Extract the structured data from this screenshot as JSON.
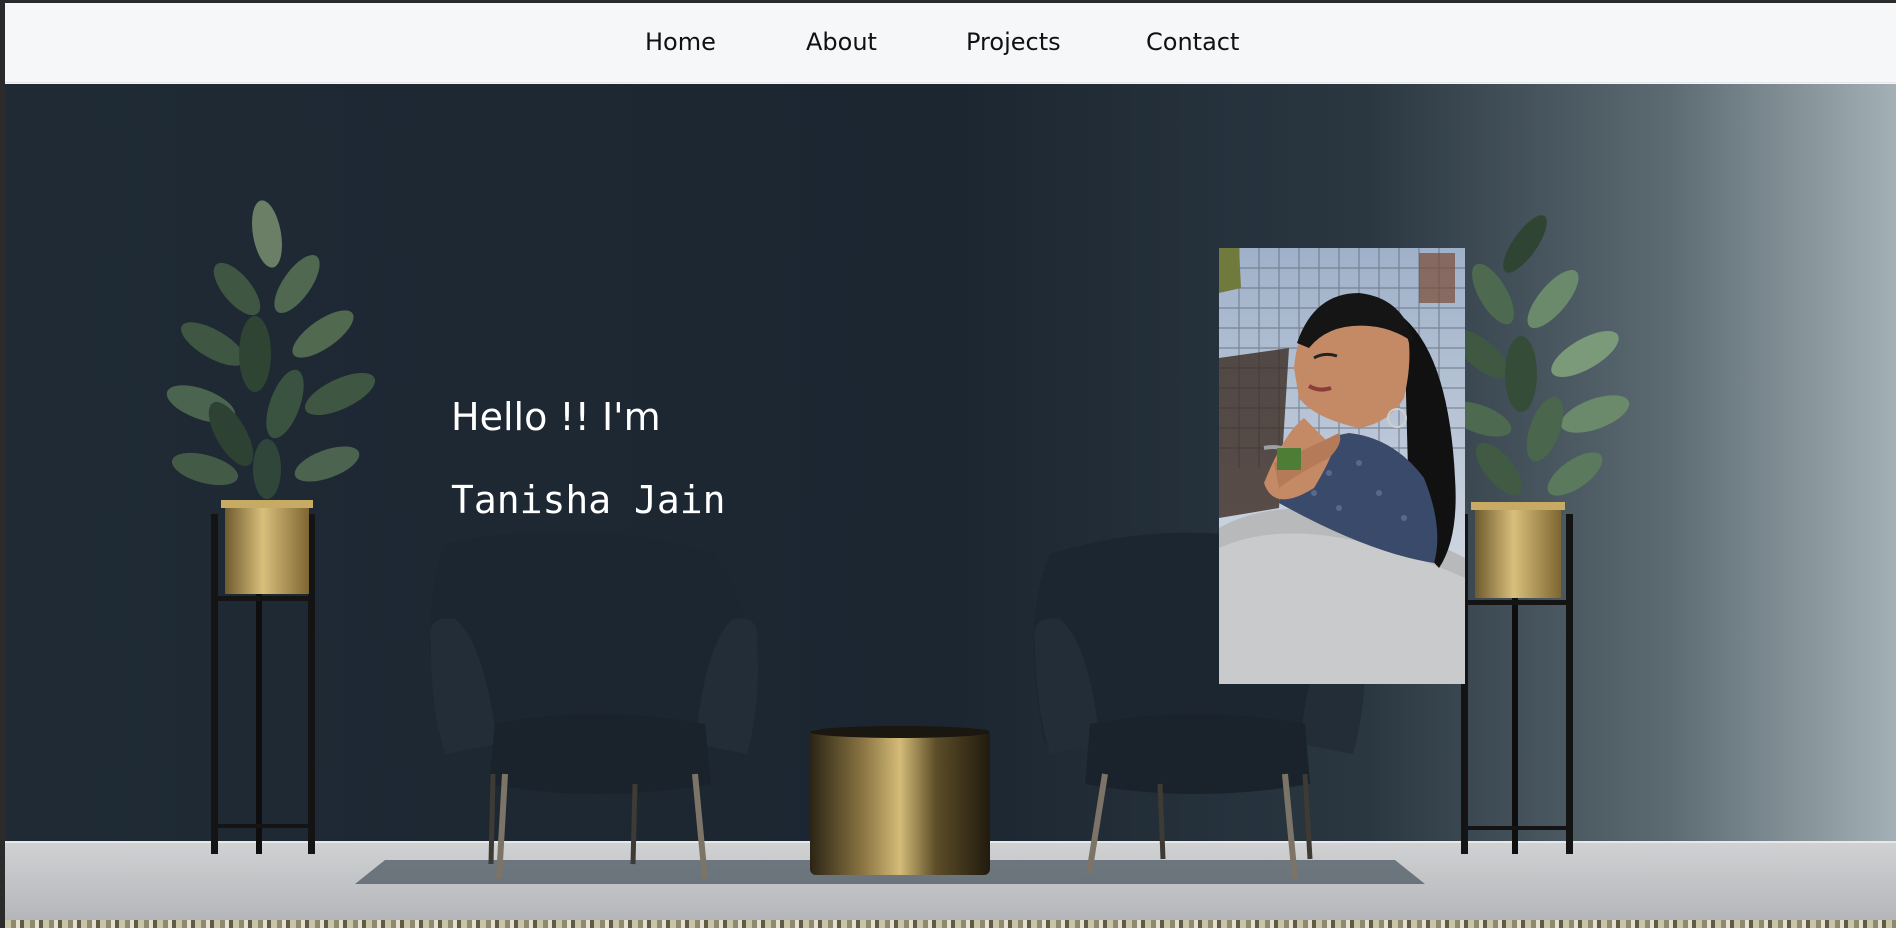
{
  "nav": {
    "items": [
      {
        "label": "Home"
      },
      {
        "label": "About"
      },
      {
        "label": "Projects"
      },
      {
        "label": "Contact"
      }
    ]
  },
  "hero": {
    "greeting": "Hello !! I'm",
    "name": "Tanisha Jain"
  },
  "colors": {
    "nav_background": "#f6f7f9",
    "wall_dark": "#1d2833",
    "wall_light": "#9aa8ae",
    "floor": "#c5c7c9",
    "text": "#ffffff",
    "gold": "#b89a55"
  }
}
